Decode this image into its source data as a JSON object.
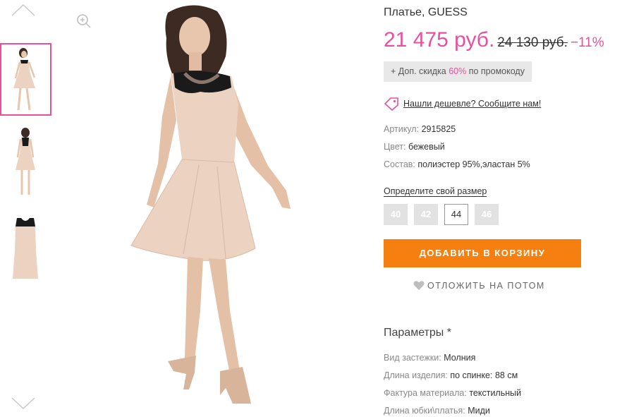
{
  "thumbnails": {
    "up_icon": "chevron-up-icon",
    "down_icon": "chevron-down-icon",
    "items": [
      {
        "view": "front"
      },
      {
        "view": "back"
      },
      {
        "view": "flat"
      }
    ]
  },
  "zoom_icon": "zoom-in-icon",
  "product": {
    "title": "Платье, GUESS",
    "price": "21 475 руб.",
    "old_price": "24 130 руб.",
    "discount": "−11%",
    "promo_prefix": "+ Доп. скидка ",
    "promo_percent": "60%",
    "promo_suffix": " по промокоду",
    "cheaper_link": "Нашли дешевле? Сообщите нам!",
    "attributes": [
      {
        "key": "Артикул:",
        "value": "2915825"
      },
      {
        "key": "Цвет:",
        "value": "бежевый"
      },
      {
        "key": "Состав:",
        "value": "полиэстер 95%,эластан 5%"
      }
    ],
    "size_link": "Определите свой размер",
    "sizes": [
      "40",
      "42",
      "44",
      "46"
    ],
    "selected_size": "44",
    "add_to_cart": "ДОБАВИТЬ В КОРЗИНУ",
    "save_later": "ОТЛОЖИТЬ НА ПОТОМ"
  },
  "parameters": {
    "title": "Параметры *",
    "items": [
      {
        "key": "Вид застежки:",
        "value": "Молния"
      },
      {
        "key": "Длина изделия:",
        "value": "по спинке: 88 см"
      },
      {
        "key": "Фактура материала:",
        "value": "текстильный"
      },
      {
        "key": "Длина юбки\\платья:",
        "value": "Миди"
      }
    ]
  },
  "colors": {
    "accent_pink": "#e8509e",
    "cart_orange": "#f57f0f",
    "size_gray": "#e2e2e2",
    "dress_beige": "#ecd2c1",
    "dress_black": "#1a1a1a"
  }
}
